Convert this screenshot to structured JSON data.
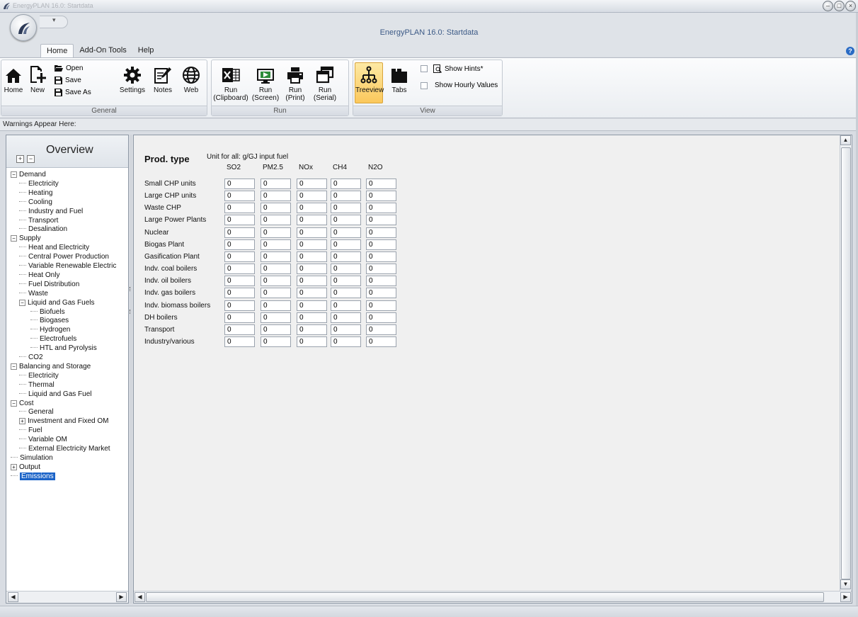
{
  "window": {
    "caption": "EnergyPLAN 16.0: Startdata",
    "title": "EnergyPLAN 16.0: Startdata",
    "controls": [
      "–",
      "□",
      "×"
    ]
  },
  "ribbon": {
    "tabs": [
      "Home",
      "Add-On Tools",
      "Help"
    ],
    "general": {
      "label": "General",
      "home": "Home",
      "new": "New",
      "open": "Open",
      "save": "Save",
      "save_as": "Save As",
      "settings": "Settings",
      "notes": "Notes",
      "web": "Web"
    },
    "run": {
      "label": "Run",
      "buttons": [
        {
          "line1": "Run",
          "line2": "(Clipboard)"
        },
        {
          "line1": "Run",
          "line2": "(Screen)"
        },
        {
          "line1": "Run",
          "line2": "(Print)"
        },
        {
          "line1": "Run",
          "line2": "(Serial)"
        }
      ]
    },
    "view": {
      "label": "View",
      "treeview": "Treeview",
      "tabs": "Tabs",
      "show_hints": "Show Hints*",
      "show_hourly": "Show Hourly Values"
    }
  },
  "warnings": "Warnings Appear Here:",
  "overview": {
    "title": "Overview",
    "tree": [
      {
        "label": "Demand",
        "level": 0,
        "toggle": "−"
      },
      {
        "label": "Electricity",
        "level": 1
      },
      {
        "label": "Heating",
        "level": 1
      },
      {
        "label": "Cooling",
        "level": 1
      },
      {
        "label": "Industry and Fuel",
        "level": 1
      },
      {
        "label": "Transport",
        "level": 1
      },
      {
        "label": "Desalination",
        "level": 1
      },
      {
        "label": "Supply",
        "level": 0,
        "toggle": "−"
      },
      {
        "label": "Heat and Electricity",
        "level": 1
      },
      {
        "label": "Central Power Production",
        "level": 1
      },
      {
        "label": "Variable Renewable Electric",
        "level": 1
      },
      {
        "label": "Heat Only",
        "level": 1
      },
      {
        "label": "Fuel Distribution",
        "level": 1
      },
      {
        "label": "Waste",
        "level": 1
      },
      {
        "label": "Liquid and Gas Fuels",
        "level": 1,
        "toggle": "−"
      },
      {
        "label": "Biofuels",
        "level": 2
      },
      {
        "label": "Biogases",
        "level": 2
      },
      {
        "label": "Hydrogen",
        "level": 2
      },
      {
        "label": "Electrofuels",
        "level": 2
      },
      {
        "label": "HTL and Pyrolysis",
        "level": 2
      },
      {
        "label": "CO2",
        "level": 1
      },
      {
        "label": "Balancing and Storage",
        "level": 0,
        "toggle": "−"
      },
      {
        "label": "Electricity",
        "level": 1
      },
      {
        "label": "Thermal",
        "level": 1
      },
      {
        "label": "Liquid and Gas Fuel",
        "level": 1
      },
      {
        "label": "Cost",
        "level": 0,
        "toggle": "−"
      },
      {
        "label": "General",
        "level": 1
      },
      {
        "label": "Investment and Fixed OM",
        "level": 1,
        "toggle": "+"
      },
      {
        "label": "Fuel",
        "level": 1
      },
      {
        "label": "Variable OM",
        "level": 1
      },
      {
        "label": "External Electricity Market",
        "level": 1
      },
      {
        "label": "Simulation",
        "level": 0
      },
      {
        "label": "Output",
        "level": 0,
        "toggle": "+"
      },
      {
        "label": "Emissions",
        "level": 0,
        "selected": true
      }
    ]
  },
  "emissions": {
    "heading": "Prod. type",
    "unit_label": "Unit for all:  g/GJ input fuel",
    "columns": [
      "SO2",
      "PM2.5",
      "NOx",
      "CH4",
      "N2O"
    ],
    "rows": [
      {
        "label": "Small CHP units",
        "values": [
          "0",
          "0",
          "0",
          "0",
          "0"
        ]
      },
      {
        "label": "Large CHP units",
        "values": [
          "0",
          "0",
          "0",
          "0",
          "0"
        ]
      },
      {
        "label": "Waste CHP",
        "values": [
          "0",
          "0",
          "0",
          "0",
          "0"
        ]
      },
      {
        "label": "Large Power Plants",
        "values": [
          "0",
          "0",
          "0",
          "0",
          "0"
        ]
      },
      {
        "label": "Nuclear",
        "values": [
          "0",
          "0",
          "0",
          "0",
          "0"
        ]
      },
      {
        "label": "Biogas Plant",
        "values": [
          "0",
          "0",
          "0",
          "0",
          "0"
        ]
      },
      {
        "label": "Gasification Plant",
        "values": [
          "0",
          "0",
          "0",
          "0",
          "0"
        ]
      },
      {
        "label": "Indv. coal boilers",
        "values": [
          "0",
          "0",
          "0",
          "0",
          "0"
        ]
      },
      {
        "label": "Indv. oil boilers",
        "values": [
          "0",
          "0",
          "0",
          "0",
          "0"
        ]
      },
      {
        "label": "Indv. gas boilers",
        "values": [
          "0",
          "0",
          "0",
          "0",
          "0"
        ]
      },
      {
        "label": "Indv. biomass boilers",
        "values": [
          "0",
          "0",
          "0",
          "0",
          "0"
        ]
      },
      {
        "label": "DH boilers",
        "values": [
          "0",
          "0",
          "0",
          "0",
          "0"
        ]
      },
      {
        "label": "Transport",
        "values": [
          "0",
          "0",
          "0",
          "0",
          "0"
        ]
      },
      {
        "label": "Industry/various",
        "values": [
          "0",
          "0",
          "0",
          "0",
          "0"
        ]
      }
    ]
  },
  "colors": {
    "selection": "#1c64c8",
    "treeview_active": "#fbc85c",
    "title_text": "#3c5a86"
  }
}
